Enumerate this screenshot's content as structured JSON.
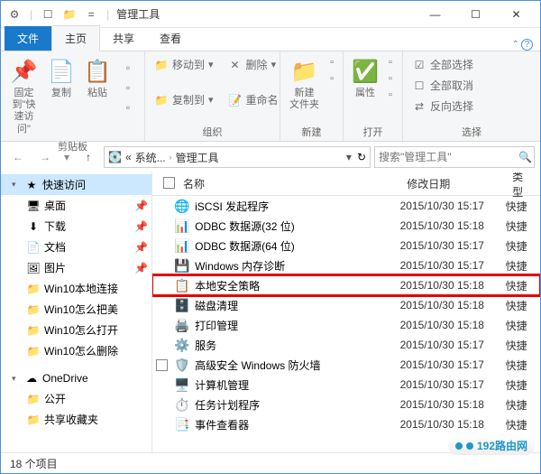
{
  "window": {
    "title": "管理工具"
  },
  "tabs": {
    "file": "文件",
    "home": "主页",
    "share": "共享",
    "view": "查看"
  },
  "ribbon": {
    "clipboard": {
      "label": "剪贴板",
      "pin": "固定到\"快\n速访问\"",
      "copy": "复制",
      "paste": "粘贴"
    },
    "organize": {
      "label": "组织",
      "move": "移动到",
      "copyto": "复制到",
      "delete": "删除",
      "rename": "重命名"
    },
    "new": {
      "label": "新建",
      "folder": "新建\n文件夹"
    },
    "open": {
      "label": "打开",
      "prop": "属性"
    },
    "select": {
      "label": "选择",
      "all": "全部选择",
      "none": "全部取消",
      "invert": "反向选择"
    }
  },
  "breadcrumb": {
    "b1": "系统...",
    "b2": "管理工具"
  },
  "search": {
    "placeholder": "搜索\"管理工具\""
  },
  "sidebar": {
    "quick": "快速访问",
    "desktop": "桌面",
    "downloads": "下载",
    "documents": "文档",
    "pictures": "图片",
    "w1": "Win10本地连接",
    "w2": "Win10怎么把美",
    "w3": "Win10怎么打开",
    "w4": "Win10怎么删除",
    "onedrive": "OneDrive",
    "public": "公开",
    "shared": "共享收藏夹"
  },
  "columns": {
    "name": "名称",
    "date": "修改日期",
    "type": "类型"
  },
  "files": [
    {
      "name": "iSCSI 发起程序",
      "date": "2015/10/30 15:17",
      "type": "快捷",
      "icon": "🌐"
    },
    {
      "name": "ODBC 数据源(32 位)",
      "date": "2015/10/30 15:18",
      "type": "快捷",
      "icon": "📊"
    },
    {
      "name": "ODBC 数据源(64 位)",
      "date": "2015/10/30 15:17",
      "type": "快捷",
      "icon": "📊"
    },
    {
      "name": "Windows 内存诊断",
      "date": "2015/10/30 15:17",
      "type": "快捷",
      "icon": "💾"
    },
    {
      "name": "本地安全策略",
      "date": "2015/10/30 15:18",
      "type": "快捷",
      "icon": "📋",
      "hl": true
    },
    {
      "name": "磁盘清理",
      "date": "2015/10/30 15:18",
      "type": "快捷",
      "icon": "🗄️"
    },
    {
      "name": "打印管理",
      "date": "2015/10/30 15:18",
      "type": "快捷",
      "icon": "🖨️"
    },
    {
      "name": "服务",
      "date": "2015/10/30 15:17",
      "type": "快捷",
      "icon": "⚙️"
    },
    {
      "name": "高级安全 Windows 防火墙",
      "date": "2015/10/30 15:17",
      "type": "快捷",
      "icon": "🛡️",
      "chk": true
    },
    {
      "name": "计算机管理",
      "date": "2015/10/30 15:17",
      "type": "快捷",
      "icon": "🖥️"
    },
    {
      "name": "任务计划程序",
      "date": "2015/10/30 15:18",
      "type": "快捷",
      "icon": "⏱️"
    },
    {
      "name": "事件查看器",
      "date": "2015/10/30 15:18",
      "type": "快捷",
      "icon": "📑"
    }
  ],
  "status": {
    "count": "18 个项目"
  },
  "watermark": "192路由网"
}
